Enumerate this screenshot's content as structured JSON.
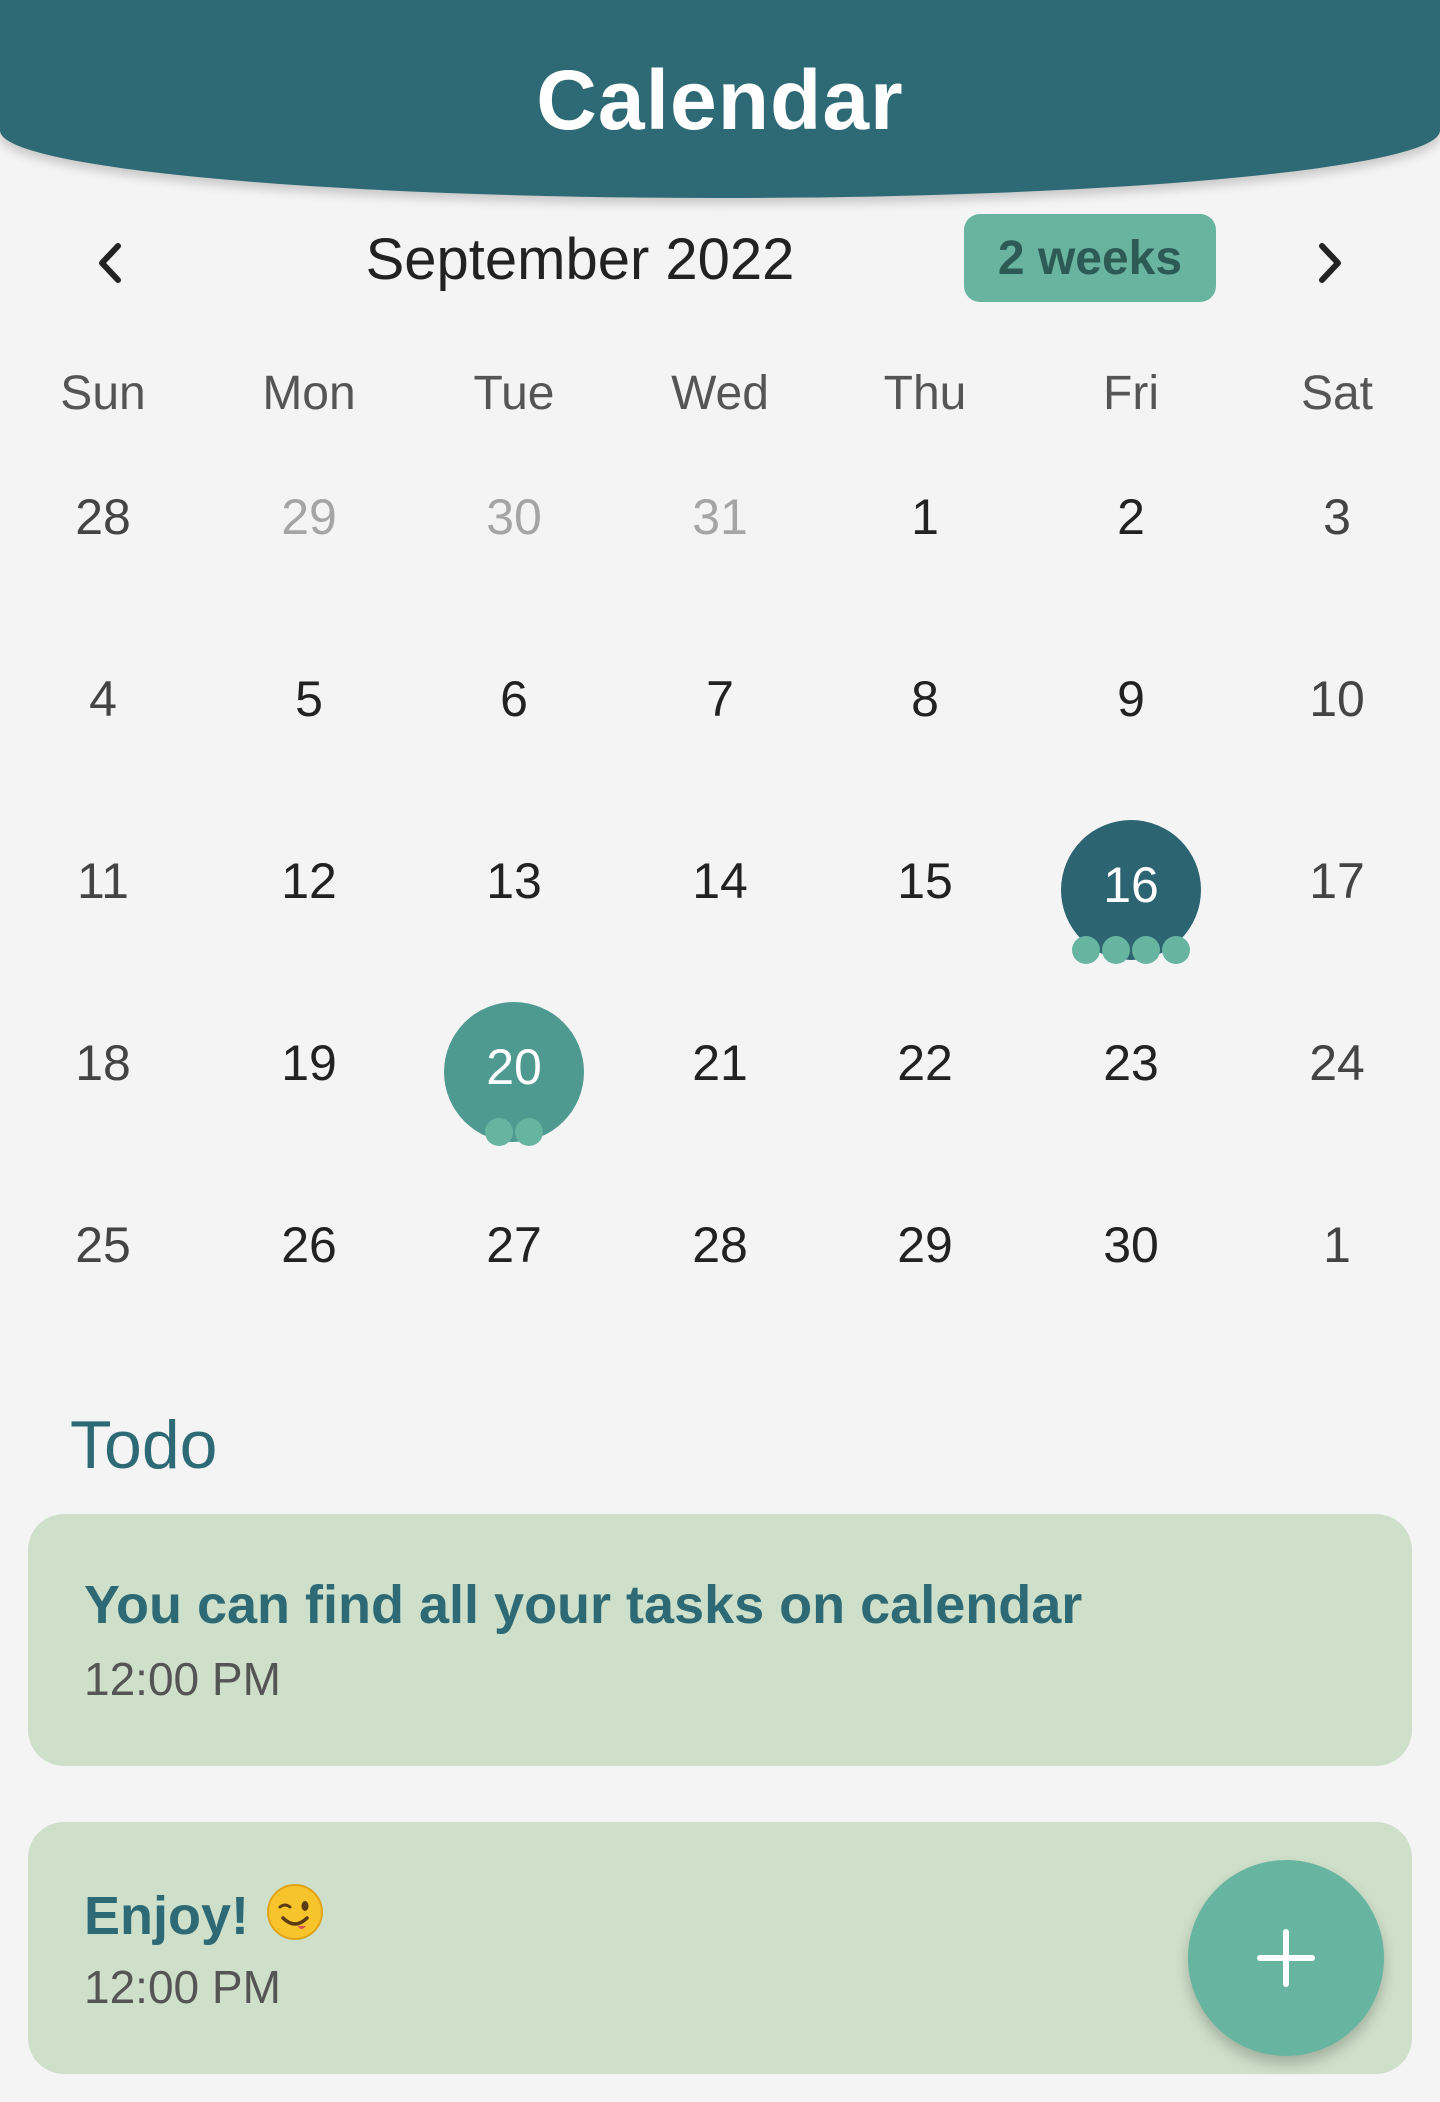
{
  "header": {
    "title": "Calendar"
  },
  "nav": {
    "month": "September 2022",
    "view_toggle": "2 weeks",
    "prev_icon": "chevron-left-icon",
    "next_icon": "chevron-right-icon"
  },
  "weekdays": [
    "Sun",
    "Mon",
    "Tue",
    "Wed",
    "Thu",
    "Fri",
    "Sat"
  ],
  "weeks": [
    [
      {
        "day": "28",
        "outside": true
      },
      {
        "day": "29",
        "outside": true
      },
      {
        "day": "30",
        "outside": true
      },
      {
        "day": "31",
        "outside": true
      },
      {
        "day": "1"
      },
      {
        "day": "2"
      },
      {
        "day": "3"
      }
    ],
    [
      {
        "day": "4"
      },
      {
        "day": "5"
      },
      {
        "day": "6"
      },
      {
        "day": "7"
      },
      {
        "day": "8"
      },
      {
        "day": "9"
      },
      {
        "day": "10"
      }
    ],
    [
      {
        "day": "11"
      },
      {
        "day": "12"
      },
      {
        "day": "13"
      },
      {
        "day": "14"
      },
      {
        "day": "15"
      },
      {
        "day": "16",
        "state": "selected",
        "events": 4
      },
      {
        "day": "17"
      }
    ],
    [
      {
        "day": "18"
      },
      {
        "day": "19"
      },
      {
        "day": "20",
        "state": "today",
        "events": 2
      },
      {
        "day": "21"
      },
      {
        "day": "22"
      },
      {
        "day": "23"
      },
      {
        "day": "24"
      }
    ],
    [
      {
        "day": "25"
      },
      {
        "day": "26"
      },
      {
        "day": "27"
      },
      {
        "day": "28"
      },
      {
        "day": "29"
      },
      {
        "day": "30"
      },
      {
        "day": "1",
        "outside": true
      }
    ]
  ],
  "todo": {
    "title": "Todo",
    "items": [
      {
        "task": "You can find all your tasks on calendar",
        "time": "12:00 PM"
      },
      {
        "task": "Enjoy!",
        "time": "12:00 PM",
        "emoji": "winking-face-icon"
      }
    ]
  },
  "fab": {
    "icon": "plus-icon"
  },
  "colors": {
    "header": "#2e6a75",
    "accent": "#67b5a0",
    "selected_day": "#2c6471",
    "today": "#4e9a91",
    "card": "#cfe0ca",
    "background": "#f4f4f4"
  }
}
